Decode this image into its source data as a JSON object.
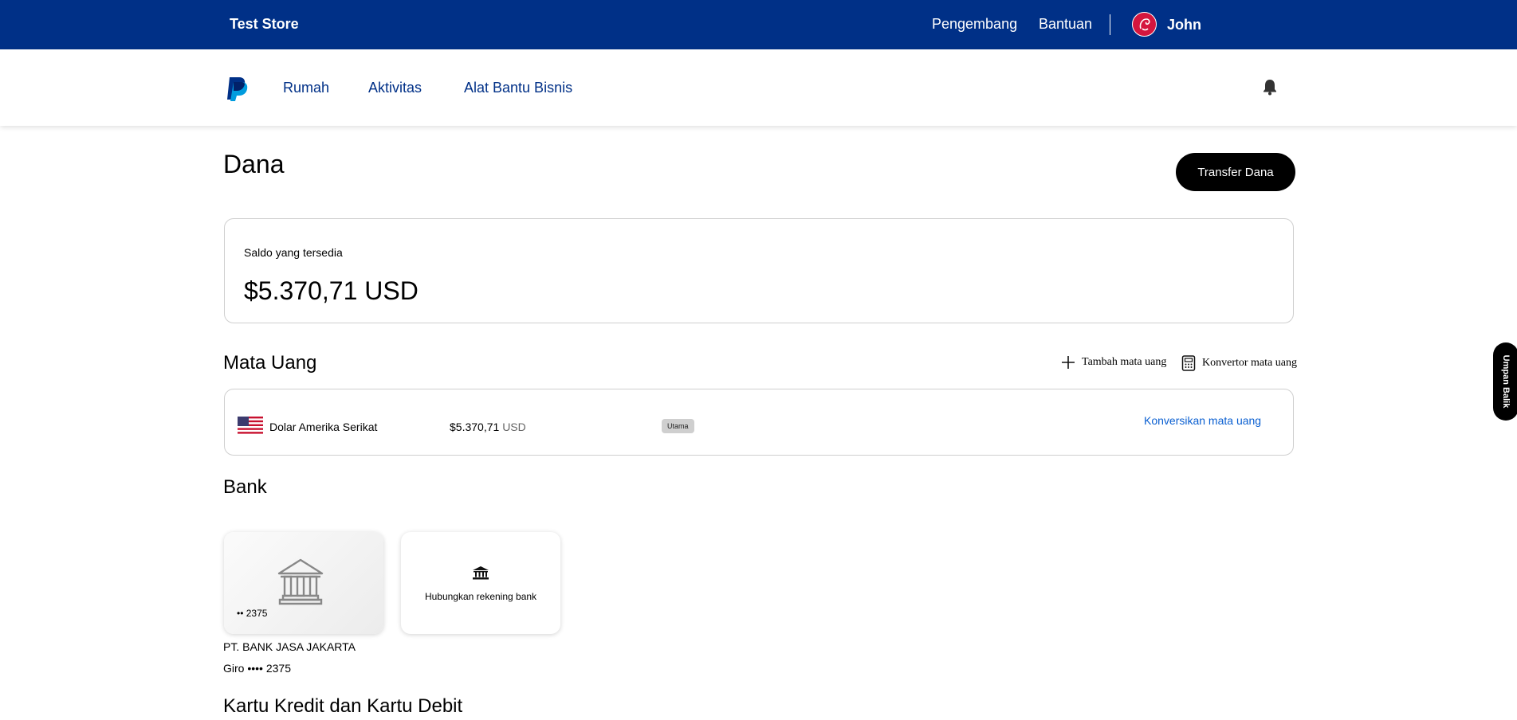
{
  "topbar": {
    "store_name": "Test Store",
    "links": [
      "Pengembang",
      "Bantuan"
    ],
    "user_name": "John"
  },
  "nav": {
    "items": [
      "Rumah",
      "Aktivitas",
      "Alat Bantu Bisnis"
    ]
  },
  "page": {
    "title": "Dana",
    "transfer_button": "Transfer Dana"
  },
  "balance": {
    "label": "Saldo yang tersedia",
    "amount": "$5.370,71 USD"
  },
  "currencies": {
    "section_title": "Mata Uang",
    "add_label": "Tambah mata uang",
    "converter_label": "Konvertor mata uang",
    "rows": [
      {
        "name": "Dolar Amerika Serikat",
        "amount": "$5.370,71",
        "code": "USD",
        "badge": "Utama",
        "action": "Konversikan mata uang"
      }
    ]
  },
  "banks": {
    "section_title": "Bank",
    "tile_masked": "•• 2375",
    "link_label": "Hubungkan rekening bank",
    "bank_name": "PT. BANK JASA JAKARTA",
    "account": "Giro •••• 2375"
  },
  "cards": {
    "section_title": "Kartu Kredit dan Kartu Debit"
  },
  "feedback": {
    "label": "Umpan Balik"
  },
  "colors": {
    "topbar": "#003087",
    "nav_text": "#003087",
    "link": "#0a5fd1",
    "avatar": "#d5163e"
  },
  "icons": [
    "paypal-logo",
    "bell-icon",
    "plus-icon",
    "calculator-icon",
    "us-flag-icon",
    "bank-icon"
  ]
}
